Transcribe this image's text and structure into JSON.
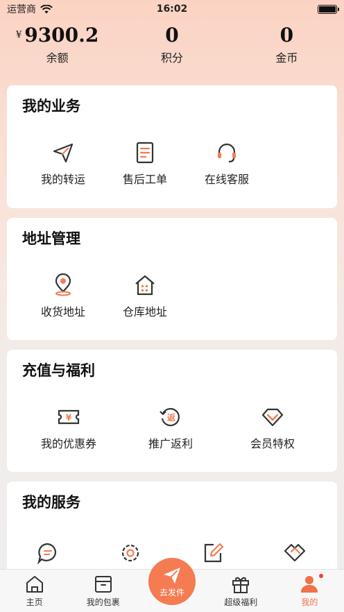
{
  "status_bar": {
    "carrier": "运营商",
    "time": "16:02"
  },
  "stats": [
    {
      "currency": "¥",
      "value": "9300.2",
      "label": "余额"
    },
    {
      "value": "0",
      "label": "积分"
    },
    {
      "value": "0",
      "label": "金币"
    }
  ],
  "sections": {
    "business": {
      "title": "我的业务",
      "items": [
        "我的转运",
        "售后工单",
        "在线客服"
      ]
    },
    "address": {
      "title": "地址管理",
      "items": [
        "收货地址",
        "仓库地址"
      ]
    },
    "welfare": {
      "title": "充值与福利",
      "items": [
        "我的优惠券",
        "推广返利",
        "会员特权"
      ]
    },
    "services": {
      "title": "我的服务"
    }
  },
  "icons": {
    "coupon_glyph": "¥",
    "rebate_glyph": "返"
  },
  "tabbar": {
    "items": [
      "主页",
      "我的包裹",
      "超级福利",
      "我的"
    ],
    "send_label": "去发件"
  },
  "colors": {
    "accent": "#f47b52",
    "active_tab": "#f07148",
    "dark_icon": "#333333"
  }
}
